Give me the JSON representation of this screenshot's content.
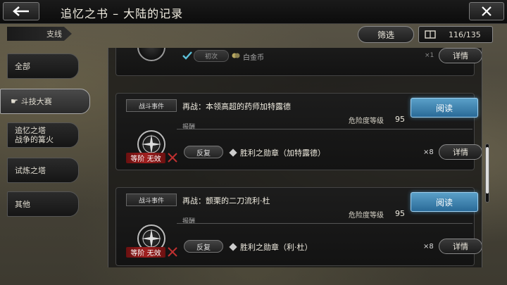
{
  "header": {
    "title": "追忆之书 – 大陆的记录"
  },
  "category": "支线",
  "filter_label": "筛选",
  "counter": "116/135",
  "sidebar": {
    "items": [
      {
        "label": "全部"
      },
      {
        "label": "斗技大赛",
        "active": true
      },
      {
        "label_line1": "追忆之塔",
        "label_line2": "战争的篝火"
      },
      {
        "label": "试炼之塔"
      },
      {
        "label": "其他"
      }
    ]
  },
  "partial_entry": {
    "first_label": "初次",
    "reward_name": "白金币",
    "qty": "×1",
    "detail_label": "详情"
  },
  "entries": [
    {
      "event_tag": "战斗事件",
      "title": "再战：本领高超的药师加特露德",
      "read_label": "阅读",
      "danger_label": "危险度等级",
      "danger_value": "95",
      "reward_label": "报酬",
      "invalid_label": "等阶 无效",
      "repeat_label": "反复",
      "reward_name": "胜利之勋章（加特露德）",
      "qty": "×8",
      "detail_label": "详情"
    },
    {
      "event_tag": "战斗事件",
      "title": "再战：颤栗的二刀流利·杜",
      "read_label": "阅读",
      "danger_label": "危险度等级",
      "danger_value": "95",
      "reward_label": "报酬",
      "invalid_label": "等阶 无效",
      "repeat_label": "反复",
      "reward_name": "胜利之勋章（利·杜）",
      "qty": "×8",
      "detail_label": "详情"
    }
  ],
  "colors": {
    "read_button": "#3a82b4",
    "invalid_badge": "#a02020"
  }
}
